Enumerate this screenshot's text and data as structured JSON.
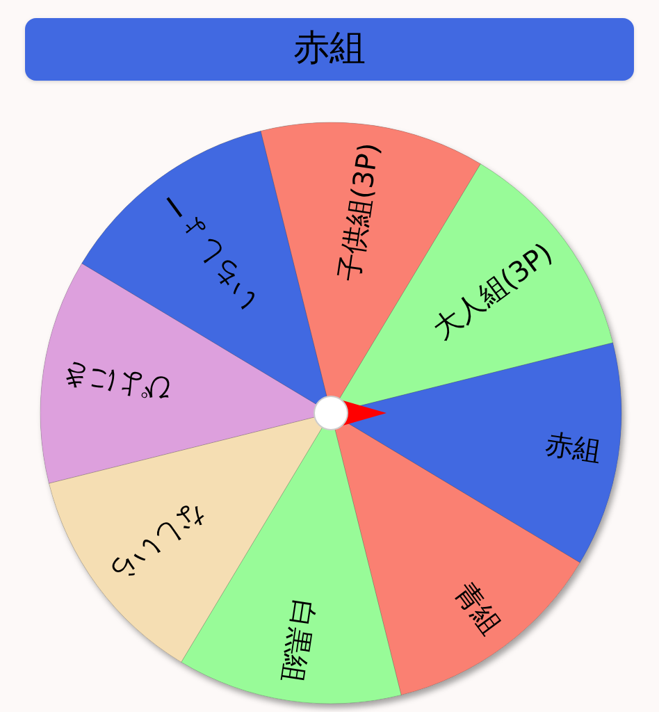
{
  "title": "赤組",
  "segments": [
    {
      "label": "子供組(3P)",
      "color": "#fa8072"
    },
    {
      "label": "大人組(3P)",
      "color": "#98fb98"
    },
    {
      "label": "赤組",
      "color": "#4169e1"
    },
    {
      "label": "青組",
      "color": "#fa8072"
    },
    {
      "label": "白黒組",
      "color": "#98fb98"
    },
    {
      "label": "なしいら",
      "color": "#f5deb3"
    },
    {
      "label": "ぴよにき",
      "color": "#dda0dd"
    },
    {
      "label": "いちしょー",
      "color": "#4169e1"
    }
  ]
}
